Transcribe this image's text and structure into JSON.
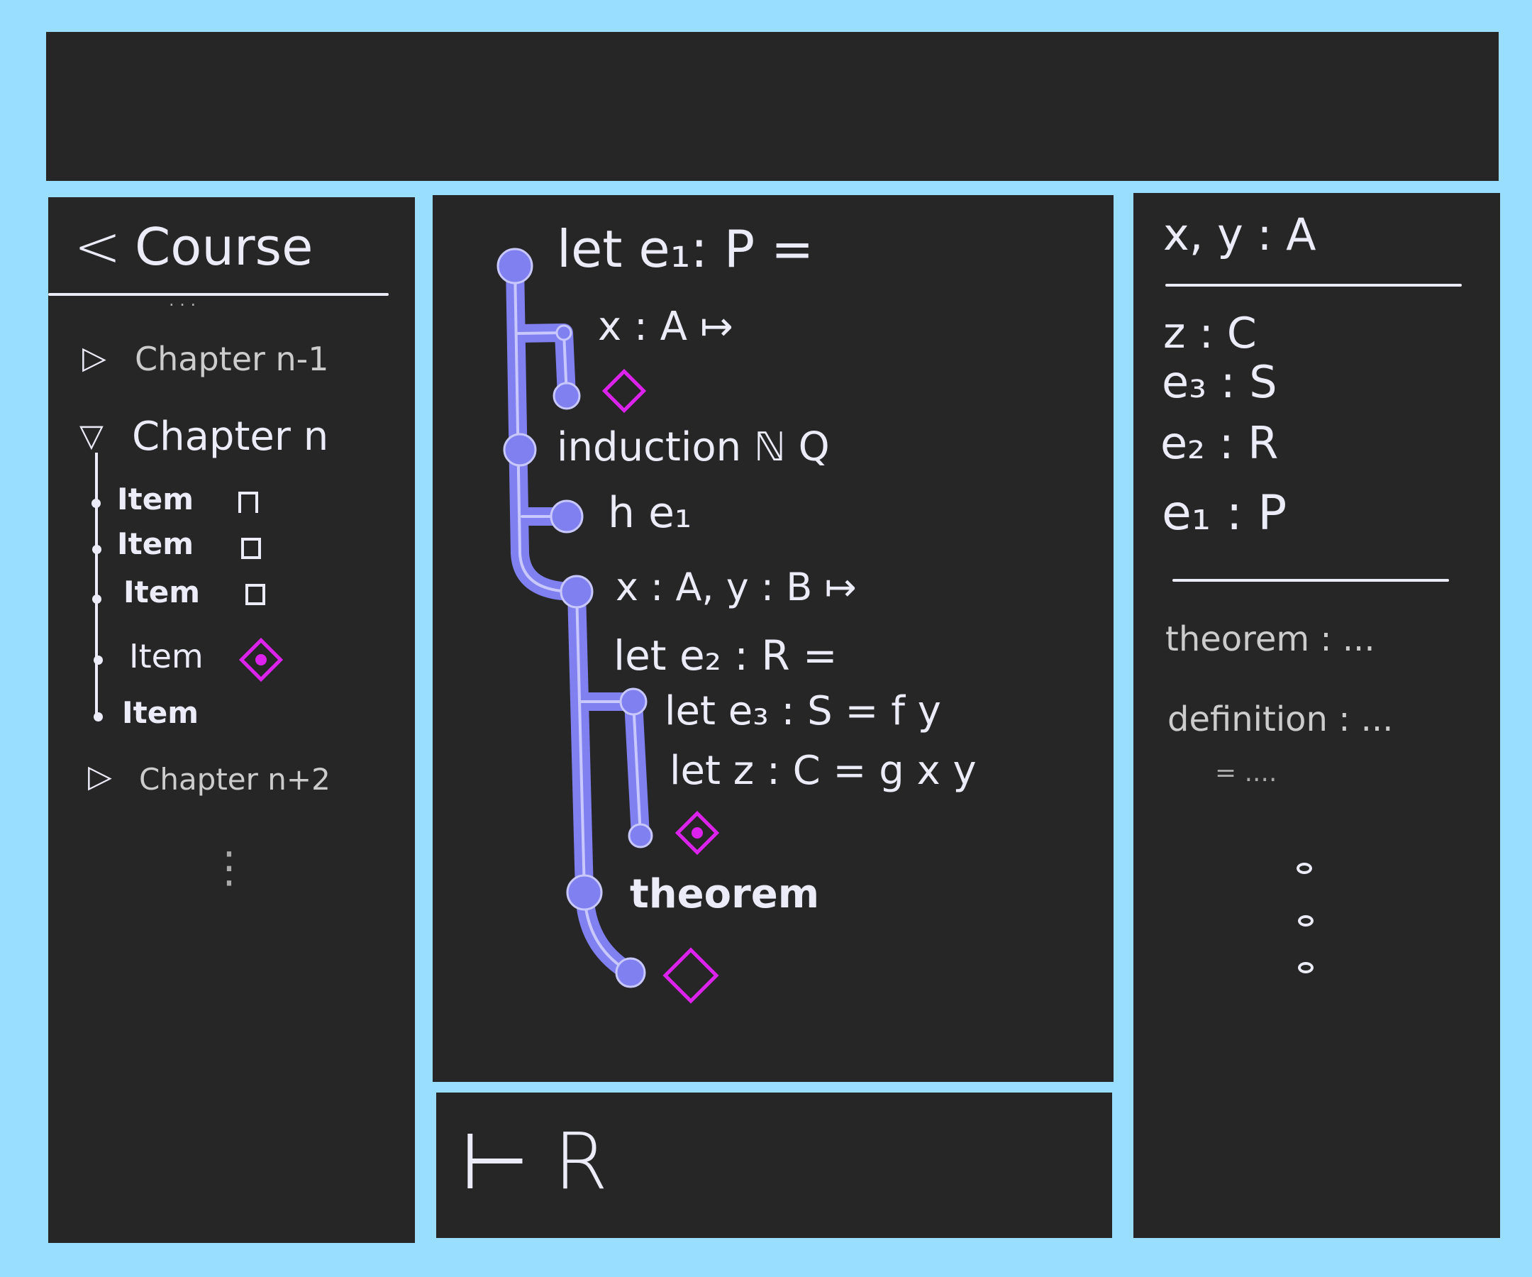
{
  "sidebar": {
    "back_label": "<",
    "title": "Course",
    "ellipsis_top": "· · ·",
    "chapters": [
      {
        "label": "Chapter n-1",
        "expanded": false
      },
      {
        "label": "Chapter n",
        "expanded": true,
        "items": [
          {
            "label": "Item",
            "status": "partial"
          },
          {
            "label": "Item",
            "status": "empty"
          },
          {
            "label": "Item",
            "status": "empty"
          },
          {
            "label": "Item",
            "status": "current-goal"
          },
          {
            "label": "Item",
            "status": "none"
          }
        ]
      },
      {
        "label": "Chapter n+2",
        "expanded": false
      }
    ],
    "ellipsis_bottom": "⋮"
  },
  "proof": {
    "lines": [
      "let e₁: P =",
      "x : A ↦",
      "induction ℕ Q",
      "h e₁",
      "x : A, y : B ↦",
      "let e₂ : R =",
      "let e₃ : S = f y",
      "let z : C = g x y",
      "theorem"
    ]
  },
  "goal_bar": {
    "text": "⊢ R"
  },
  "context": {
    "header": "x, y : A",
    "hyps": [
      "z : C",
      "e₃ : S",
      "e₂ : R",
      "e₁ : P"
    ],
    "lemmas": [
      "theorem : ...",
      "definition : ...",
      "= ...."
    ]
  },
  "colors": {
    "background": "#99ddff",
    "panel": "#262626",
    "tree": "#8080f0",
    "goal": "#dd22ee",
    "ink": "#ececf8"
  }
}
